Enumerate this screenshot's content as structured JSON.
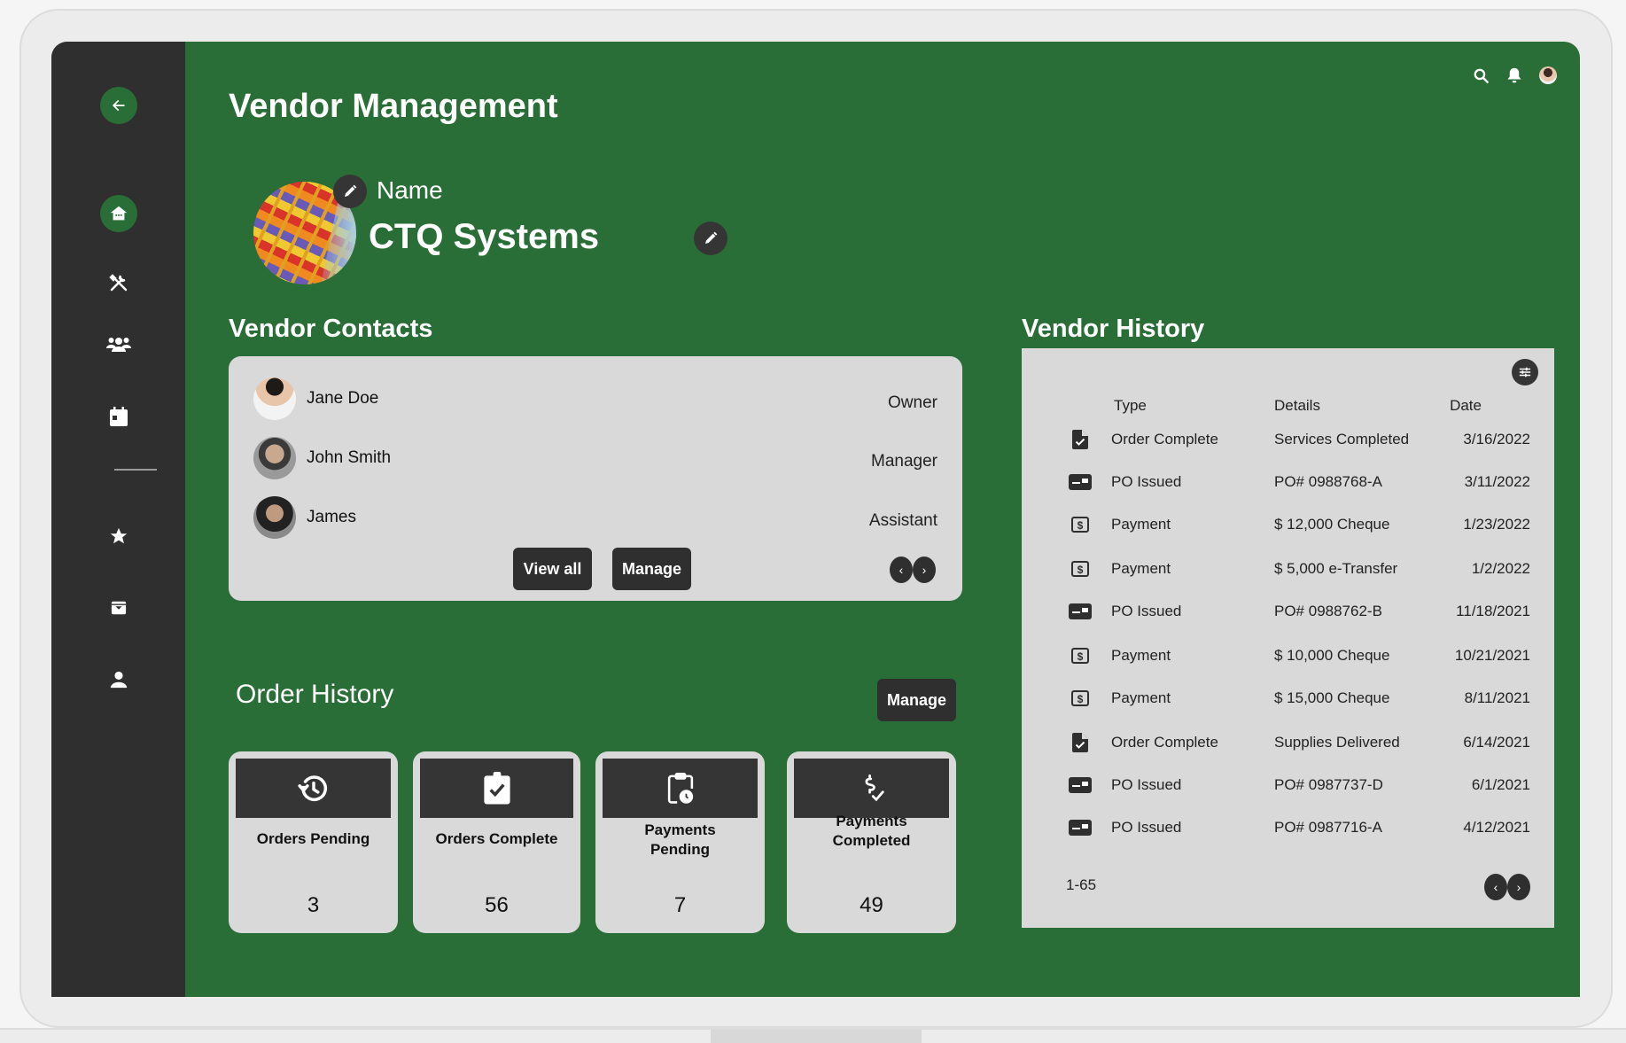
{
  "header": {
    "title": "Vendor Management",
    "top_icons": [
      "search-icon",
      "bell-icon",
      "user-avatar"
    ]
  },
  "sidebar": {
    "back_icon": "arrow-left-icon",
    "items": [
      {
        "name": "home",
        "icon": "home-icon",
        "active": true
      },
      {
        "name": "tools",
        "icon": "tools-icon",
        "active": false
      },
      {
        "name": "people",
        "icon": "people-icon",
        "active": false
      },
      {
        "name": "calendar",
        "icon": "calendar-icon",
        "active": false
      },
      {
        "name": "favorites",
        "icon": "star-icon",
        "active": false
      },
      {
        "name": "archive",
        "icon": "archive-icon",
        "active": false
      },
      {
        "name": "profile",
        "icon": "person-icon",
        "active": false
      }
    ]
  },
  "vendor": {
    "name_label": "Name",
    "company_name": "CTQ Systems"
  },
  "contacts": {
    "title": "Vendor Contacts",
    "items": [
      {
        "name": "Jane Doe",
        "role": "Owner"
      },
      {
        "name": "John Smith",
        "role": "Manager"
      },
      {
        "name": "James",
        "role": "Assistant"
      }
    ],
    "view_all_label": "View all",
    "manage_label": "Manage",
    "prev": "‹",
    "next": "›"
  },
  "orders": {
    "title": "Order History",
    "manage_label": "Manage",
    "stats": [
      {
        "label": "Orders Pending",
        "value": "3",
        "icon": "history-icon"
      },
      {
        "label": "Orders Complete",
        "value": "56",
        "icon": "clipboard-check-icon"
      },
      {
        "label": "Payments Pending",
        "value": "7",
        "icon": "clipboard-clock-icon"
      },
      {
        "label": "Payments Completed",
        "value": "49",
        "icon": "dollar-check-icon"
      }
    ]
  },
  "history": {
    "title": "Vendor History",
    "columns": {
      "type": "Type",
      "details": "Details",
      "date": "Date"
    },
    "rows": [
      {
        "icon": "file-check-icon",
        "type": "Order Complete",
        "details": "Services Completed",
        "date": "3/16/2022"
      },
      {
        "icon": "card-icon",
        "type": "PO Issued",
        "details": "PO# 0988768-A",
        "date": "3/11/2022"
      },
      {
        "icon": "dollar-icon",
        "type": "Payment",
        "details": "$ 12,000 Cheque",
        "date": "1/23/2022"
      },
      {
        "icon": "dollar-icon",
        "type": "Payment",
        "details": "$ 5,000 e-Transfer",
        "date": "1/2/2022"
      },
      {
        "icon": "card-icon",
        "type": "PO Issued",
        "details": "PO# 0988762-B",
        "date": "11/18/2021"
      },
      {
        "icon": "dollar-icon",
        "type": "Payment",
        "details": "$ 10,000 Cheque",
        "date": "10/21/2021"
      },
      {
        "icon": "dollar-icon",
        "type": "Payment",
        "details": "$ 15,000 Cheque",
        "date": "8/11/2021"
      },
      {
        "icon": "file-check-icon",
        "type": "Order Complete",
        "details": "Supplies Delivered",
        "date": "6/14/2021"
      },
      {
        "icon": "card-icon",
        "type": "PO Issued",
        "details": "PO# 0987737-D",
        "date": "6/1/2021"
      },
      {
        "icon": "card-icon",
        "type": "PO Issued",
        "details": "PO# 0987716-A",
        "date": "4/12/2021"
      }
    ],
    "range": "1-65",
    "prev": "‹",
    "next": "›"
  },
  "colors": {
    "brand_green": "#2a6e37",
    "sidebar_dark": "#2f2f2f",
    "card_gray": "#d9d9d9"
  }
}
